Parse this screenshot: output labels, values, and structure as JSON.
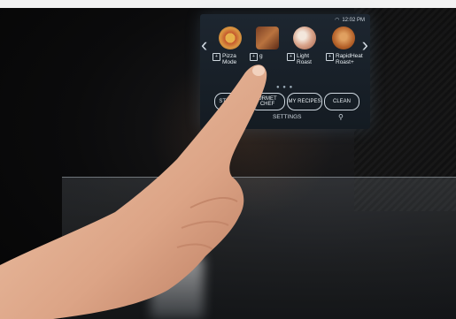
{
  "status": {
    "time": "12:02 PM"
  },
  "panel": {
    "modes": [
      {
        "label": "Pizza Mode",
        "food": "pizza"
      },
      {
        "label": "g",
        "food": "steak-skewers"
      },
      {
        "label": "Light Roast",
        "food": "ham"
      },
      {
        "label": "RapidHeat Roast+",
        "food": "roast-chicken"
      }
    ],
    "buttons": [
      {
        "label": "STEA CE"
      },
      {
        "label": "URMET CHEF"
      },
      {
        "label": "MY RECIPES"
      },
      {
        "label": "CLEAN"
      }
    ],
    "settings_label": "SETTINGS",
    "colors": {
      "panel": "#1d2630",
      "text": "#e8eef2"
    }
  },
  "icons": [
    "wifi-icon",
    "chevron-left-icon",
    "chevron-right-icon",
    "light-icon",
    "mode-icon"
  ]
}
